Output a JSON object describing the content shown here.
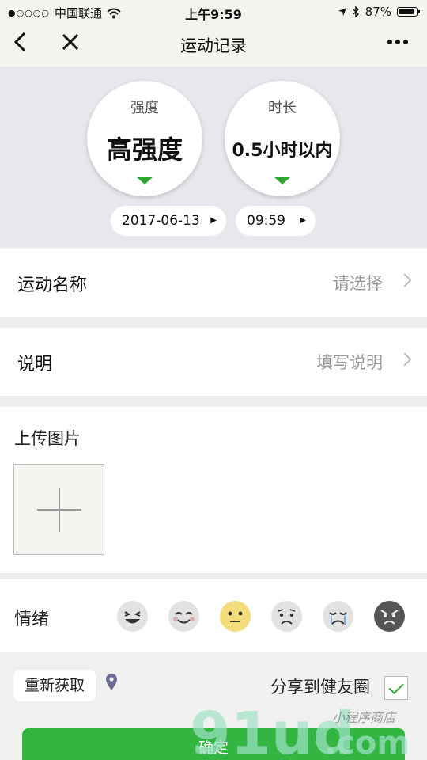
{
  "status_bar": {
    "carrier": "中国联通",
    "signal": "●○○○○",
    "time": "上午9:59",
    "battery": "87%"
  },
  "nav": {
    "back_icon": "chevron-left-icon",
    "close_icon": "close-icon",
    "title": "运动记录",
    "more_icon": "more-icon"
  },
  "selectors": {
    "intensity": {
      "label": "强度",
      "value": "高强度"
    },
    "duration": {
      "label": "时长",
      "value": "0.5小时以内"
    },
    "date": "2017-06-13",
    "time": "09:59",
    "accent": "#2ca832"
  },
  "rows": {
    "sport_name": {
      "label": "运动名称",
      "value": "请选择"
    },
    "description": {
      "label": "说明",
      "value": "填写说明"
    }
  },
  "upload": {
    "title": "上传图片"
  },
  "mood": {
    "label": "情绪",
    "options": [
      "laughing-face",
      "smiling-face",
      "neutral-face",
      "sad-face",
      "crying-face",
      "angry-face"
    ],
    "selected": "neutral-face"
  },
  "bottom": {
    "refresh_label": "重新获取",
    "share_label": "分享到健友圈",
    "share_checked": true,
    "confirm_label": "确定",
    "confirm_color": "#32b641"
  },
  "watermark": {
    "text": "91ud",
    "domain": ".com",
    "script": "小程序商店"
  }
}
